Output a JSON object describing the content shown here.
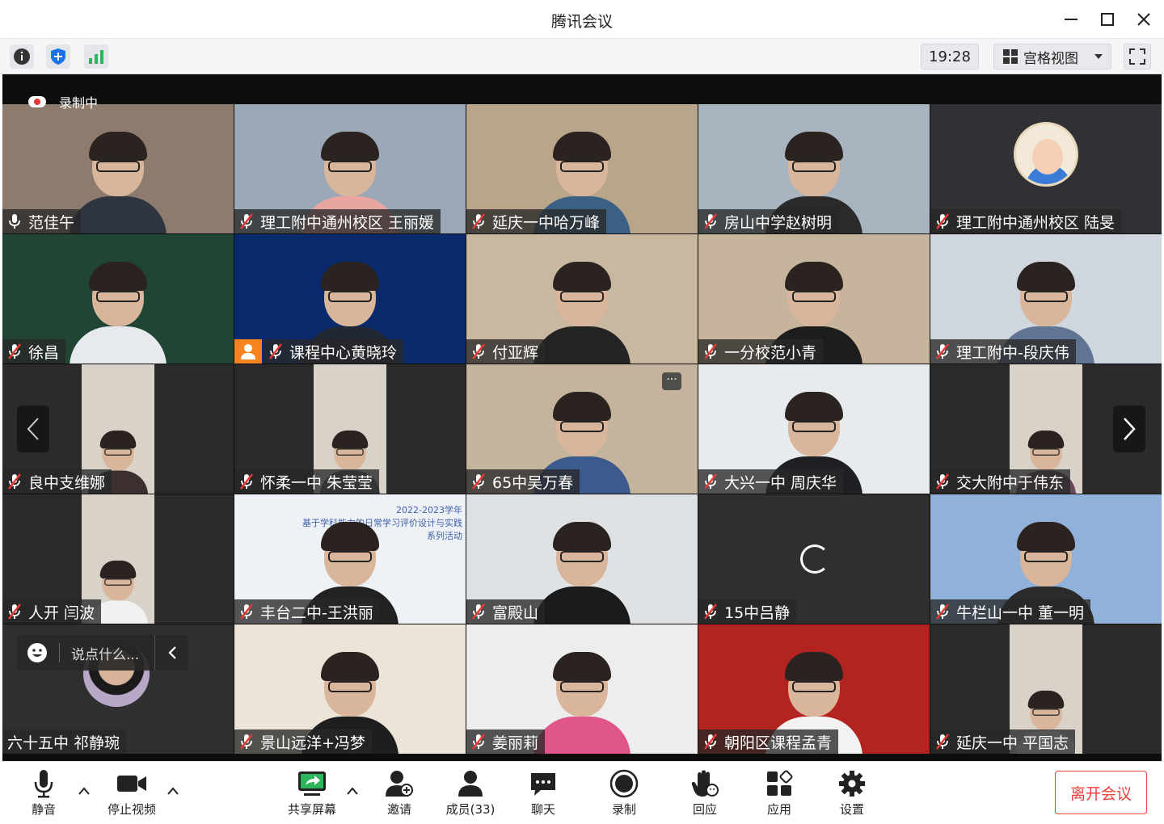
{
  "window": {
    "title": "腾讯会议"
  },
  "toolbar": {
    "time": "19:28",
    "view_mode": "宫格视图"
  },
  "recording": {
    "label": "录制中"
  },
  "participants": [
    {
      "name": "范佳午",
      "mic": "on",
      "bg": "#8d7c6d",
      "shirt": "#2f3540"
    },
    {
      "name": "理工附中通州校区 王丽媛",
      "mic": "off",
      "bg": "#9aa8b8",
      "shirt": "#e9a6a0"
    },
    {
      "name": "延庆一中哈万峰",
      "mic": "off",
      "bg": "#b9a58a",
      "shirt": "#3c5f84"
    },
    {
      "name": "房山中学赵树明",
      "mic": "off",
      "bg": "#a8b4c0",
      "shirt": "#2a2a2a"
    },
    {
      "name": "理工附中通州校区 陆旻",
      "mic": "off",
      "bg": "#2f3135",
      "shirt": "none",
      "avatar": "cartoon"
    },
    {
      "name": "徐昌",
      "mic": "off",
      "bg": "#204535",
      "shirt": "#e6e9ee"
    },
    {
      "name": "课程中心黄晓玲",
      "mic": "off",
      "bg": "#0a2a6b",
      "shirt": "#222833",
      "badge": "orange"
    },
    {
      "name": "付亚辉",
      "mic": "off",
      "bg": "#c9b8a0",
      "shirt": "#242424"
    },
    {
      "name": "一分校范小青",
      "mic": "off",
      "bg": "#c6b49c",
      "shirt": "#1d1d1d"
    },
    {
      "name": "理工附中-段庆伟",
      "mic": "off",
      "bg": "#cfd6de",
      "shirt": "#5f7591"
    },
    {
      "name": "良中支维娜",
      "mic": "off",
      "bg": "#2b2b2b",
      "shirt": "#3b2f2f"
    },
    {
      "name": "怀柔一中 朱莹莹",
      "mic": "off",
      "bg": "#2b2b2b",
      "shirt": "#5a5f66"
    },
    {
      "name": "65中吴万春",
      "mic": "off",
      "bg": "#c4b49e",
      "shirt": "#3d5a8c",
      "more": true
    },
    {
      "name": "大兴一中 周庆华",
      "mic": "off",
      "bg": "#e8ebee",
      "shirt": "#1f2024"
    },
    {
      "name": "交大附中于伟东",
      "mic": "off",
      "bg": "#2b2b2b",
      "shirt": "#6a4a5a"
    },
    {
      "name": "人开 闫波",
      "mic": "off",
      "bg": "#2b2b2b",
      "shirt": "#f1f1f1"
    },
    {
      "name": "丰台二中-王洪丽",
      "mic": "off",
      "bg": "#eef1f6",
      "shirt": "#222222",
      "slide": true
    },
    {
      "name": "富殿山",
      "mic": "off",
      "bg": "#dfe2e4",
      "shirt": "#1a1a1a"
    },
    {
      "name": "15中吕静",
      "mic": "off",
      "bg": "#2f2f2f",
      "shirt": "none",
      "loading": true
    },
    {
      "name": "牛栏山一中 董一明",
      "mic": "off",
      "bg": "#8fb1da",
      "shirt": "#2b2b2b"
    },
    {
      "name": "六十五中 祁静琬",
      "mic": "none",
      "bg": "#2f2f2f",
      "shirt": "none",
      "avatar": "circle"
    },
    {
      "name": "景山远洋+冯梦",
      "mic": "off",
      "bg": "#ece4d6",
      "shirt": "#1e1e1e"
    },
    {
      "name": "姜丽莉",
      "mic": "off",
      "bg": "#ededed",
      "shirt": "#e0568a"
    },
    {
      "name": "朝阳区课程孟青",
      "mic": "off",
      "bg": "#b3231f",
      "shirt": "#f2f2f2"
    },
    {
      "name": "延庆一中 平国志",
      "mic": "off",
      "bg": "#2b2b2b",
      "shirt": "#f4f4f4"
    }
  ],
  "slide": {
    "line1": "2022-2023学年",
    "line2": "基于学科能力的日常学习评价设计与实践",
    "line3": "系列活动"
  },
  "chat": {
    "placeholder": "说点什么..."
  },
  "bottom": {
    "mute": "静音",
    "stop_video": "停止视频",
    "share": "共享屏幕",
    "invite": "邀请",
    "members": "成员(33)",
    "chat": "聊天",
    "record": "录制",
    "reaction": "回应",
    "apps": "应用",
    "settings": "设置",
    "leave": "离开会议"
  }
}
